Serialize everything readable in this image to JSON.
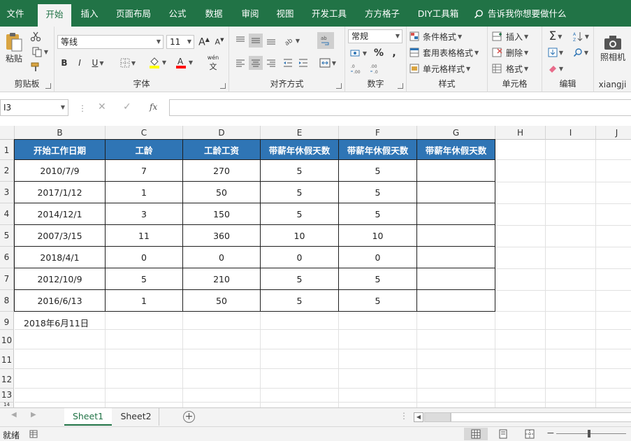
{
  "tabs": [
    "文件",
    "开始",
    "插入",
    "页面布局",
    "公式",
    "数据",
    "审阅",
    "视图",
    "开发工具",
    "方方格子",
    "DIY工具箱"
  ],
  "tell_me": "告诉我你想要做什么",
  "ribbon": {
    "clipboard": {
      "paste": "粘贴",
      "label": "剪贴板"
    },
    "font": {
      "name": "等线",
      "size": "11",
      "bold": "B",
      "italic": "I",
      "underline": "U",
      "label": "字体",
      "phonetic": "wén"
    },
    "alignment": {
      "label": "对齐方式"
    },
    "number": {
      "format": "常规",
      "label": "数字",
      "percent": "%"
    },
    "styles": {
      "conditional": "条件格式",
      "table": "套用表格格式",
      "cell": "单元格样式",
      "label": "样式"
    },
    "cells": {
      "insert": "插入",
      "delete": "删除",
      "format": "格式",
      "label": "单元格"
    },
    "editing": {
      "label": "编辑"
    },
    "camera": {
      "label": "照相机",
      "group": "xiangji"
    }
  },
  "formula_bar": {
    "name_box": "I3",
    "fx": "fx",
    "formula": ""
  },
  "columns": [
    "B",
    "C",
    "D",
    "E",
    "F",
    "G",
    "H",
    "I",
    "J"
  ],
  "rows": [
    "1",
    "2",
    "3",
    "4",
    "5",
    "6",
    "7",
    "8",
    "9",
    "10",
    "11",
    "12",
    "13",
    "14"
  ],
  "table": {
    "headers": [
      "开始工作日期",
      "工龄",
      "工龄工资",
      "带薪年休假天数",
      "带薪年休假天数",
      "带薪年休假天数"
    ],
    "rows": [
      [
        "2010/7/9",
        "7",
        "270",
        "5",
        "5",
        ""
      ],
      [
        "2017/1/12",
        "1",
        "50",
        "5",
        "5",
        ""
      ],
      [
        "2014/12/1",
        "3",
        "150",
        "5",
        "5",
        ""
      ],
      [
        "2007/3/15",
        "11",
        "360",
        "10",
        "10",
        ""
      ],
      [
        "2018/4/1",
        "0",
        "0",
        "0",
        "0",
        ""
      ],
      [
        "2012/10/9",
        "5",
        "210",
        "5",
        "5",
        ""
      ],
      [
        "2016/6/13",
        "1",
        "50",
        "5",
        "5",
        ""
      ]
    ]
  },
  "note_b9": "2018年6月11日",
  "sheets": [
    "Sheet1",
    "Sheet2"
  ],
  "status": {
    "ready": "就绪"
  },
  "colors": {
    "excel_green": "#217346",
    "header_blue": "#2f75b5",
    "fill_yellow": "#ffff00",
    "font_red": "#ff0000"
  }
}
